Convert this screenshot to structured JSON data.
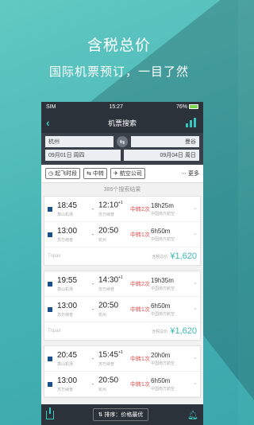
{
  "hero": {
    "title": "含税总价",
    "subtitle": "国际机票预订，一目了然"
  },
  "status": {
    "carrier": "SIM",
    "time": "15:27",
    "battery": "76%"
  },
  "nav": {
    "title": "机票搜索",
    "back_icon": "chevron-left-icon",
    "chart_icon": "bar-chart-icon"
  },
  "search": {
    "from_city": "杭州",
    "to_city": "曼谷",
    "depart_date": "09月01日 周四",
    "return_date": "09月04日 周日"
  },
  "filters": {
    "time": "起飞时段",
    "transfer": "中转",
    "airline": "航空公司",
    "more": "更多"
  },
  "result_count": "386个搜索结果",
  "cards": [
    {
      "flights": [
        {
          "dep": "18:45",
          "dep_sub": "萧山机场",
          "arr": "12:10",
          "arr_plus": "+1",
          "arr_sub": "苏万纳普",
          "stops": "中转2次",
          "duration": "18h25m",
          "airline": "中国南方航空"
        },
        {
          "dep": "13:00",
          "dep_sub": "苏万纳普",
          "arr": "20:50",
          "arr_plus": "",
          "arr_sub": "杭州",
          "stops": "中转1次",
          "duration": "6h50m",
          "airline": "中国南方航空"
        }
      ],
      "source": "Tripair",
      "price_label": "含税总价",
      "price": "¥1,620"
    },
    {
      "flights": [
        {
          "dep": "19:55",
          "dep_sub": "萧山机场",
          "arr": "14:30",
          "arr_plus": "+1",
          "arr_sub": "苏万纳普",
          "stops": "中转2次",
          "duration": "19h35m",
          "airline": "中国南方航空"
        },
        {
          "dep": "13:00",
          "dep_sub": "苏万纳普",
          "arr": "20:50",
          "arr_plus": "",
          "arr_sub": "杭州",
          "stops": "中转1次",
          "duration": "6h50m",
          "airline": "中国南方航空"
        }
      ],
      "source": "Tripair",
      "price_label": "含税总价",
      "price": "¥1,620"
    },
    {
      "flights": [
        {
          "dep": "20:45",
          "dep_sub": "萧山机场",
          "arr": "15:45",
          "arr_plus": "+1",
          "arr_sub": "苏万纳普",
          "stops": "中转1次",
          "duration": "20h0m",
          "airline": "中国南方航空"
        },
        {
          "dep": "13:00",
          "dep_sub": "苏万纳普",
          "arr": "20:50",
          "arr_plus": "",
          "arr_sub": "杭州",
          "stops": "中转1次",
          "duration": "6h50m",
          "airline": "中国南方航空"
        }
      ],
      "source": "",
      "price_label": "",
      "price": ""
    }
  ],
  "bottom": {
    "sort_label": "排序：价格最优"
  },
  "colors": {
    "accent": "#36c7c0",
    "price": "#3cb8b4",
    "stops": "#e04848",
    "bar": "#2c323a"
  }
}
